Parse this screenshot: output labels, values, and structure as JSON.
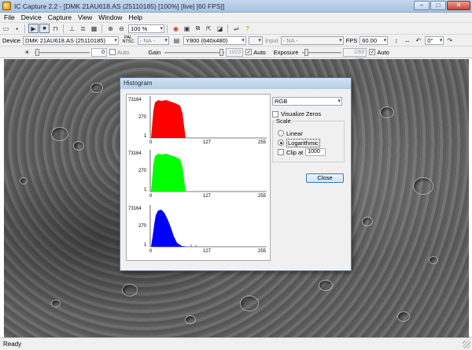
{
  "window": {
    "title": "IC Capture 2.2 - [DMK 21AU618.AS (25110185) [100%] [live] [60 FPS]]",
    "controls": [
      "minimize-icon",
      "maximize-icon",
      "close-icon"
    ]
  },
  "menu": {
    "items": [
      "File",
      "Device",
      "Capture",
      "View",
      "Window",
      "Help"
    ]
  },
  "toolbar1": {
    "zoom_value": "100 %"
  },
  "toolbar2": {
    "device_label": "Device",
    "device_value": "DMK 21AU618.AS (25110185)",
    "pal_label": "PAL NTSC",
    "norm_value": "- NA -",
    "format_value": "Y800 (640x480)",
    "input_label": "Input",
    "input_value": "- NA -",
    "fps_label": "FPS",
    "fps_value": "60.00",
    "rotation_value": "0°"
  },
  "toolbar3": {
    "brightness_value": "0",
    "brightness_auto_label": "Auto",
    "brightness_auto_checked": false,
    "gain_label": "Gain",
    "gain_value": "1023",
    "gain_auto_label": "Auto",
    "gain_auto_checked": true,
    "exposure_label": "Exposure",
    "exposure_value": "1/60 sec",
    "exposure_auto_label": "Auto",
    "exposure_auto_checked": true
  },
  "histogram": {
    "title": "Histogram",
    "channel_value": "RGB",
    "visualize_zeros_label": "Visualize Zeros",
    "visualize_zeros_checked": false,
    "scale_label": "Scale",
    "linear_label": "Linear",
    "logarithmic_label": "Logarithmic",
    "selected_scale": "Logarithmic",
    "clip_label": "Clip at",
    "clip_checked": false,
    "clip_value": "1000",
    "close_label": "Close",
    "y_ticks": [
      "73164",
      "270",
      "1"
    ],
    "x_ticks": [
      "0",
      "127",
      "255"
    ],
    "colors": {
      "red": "#ff0000",
      "green": "#00ff00",
      "blue": "#0000ff"
    }
  },
  "status": {
    "text": "Ready"
  }
}
